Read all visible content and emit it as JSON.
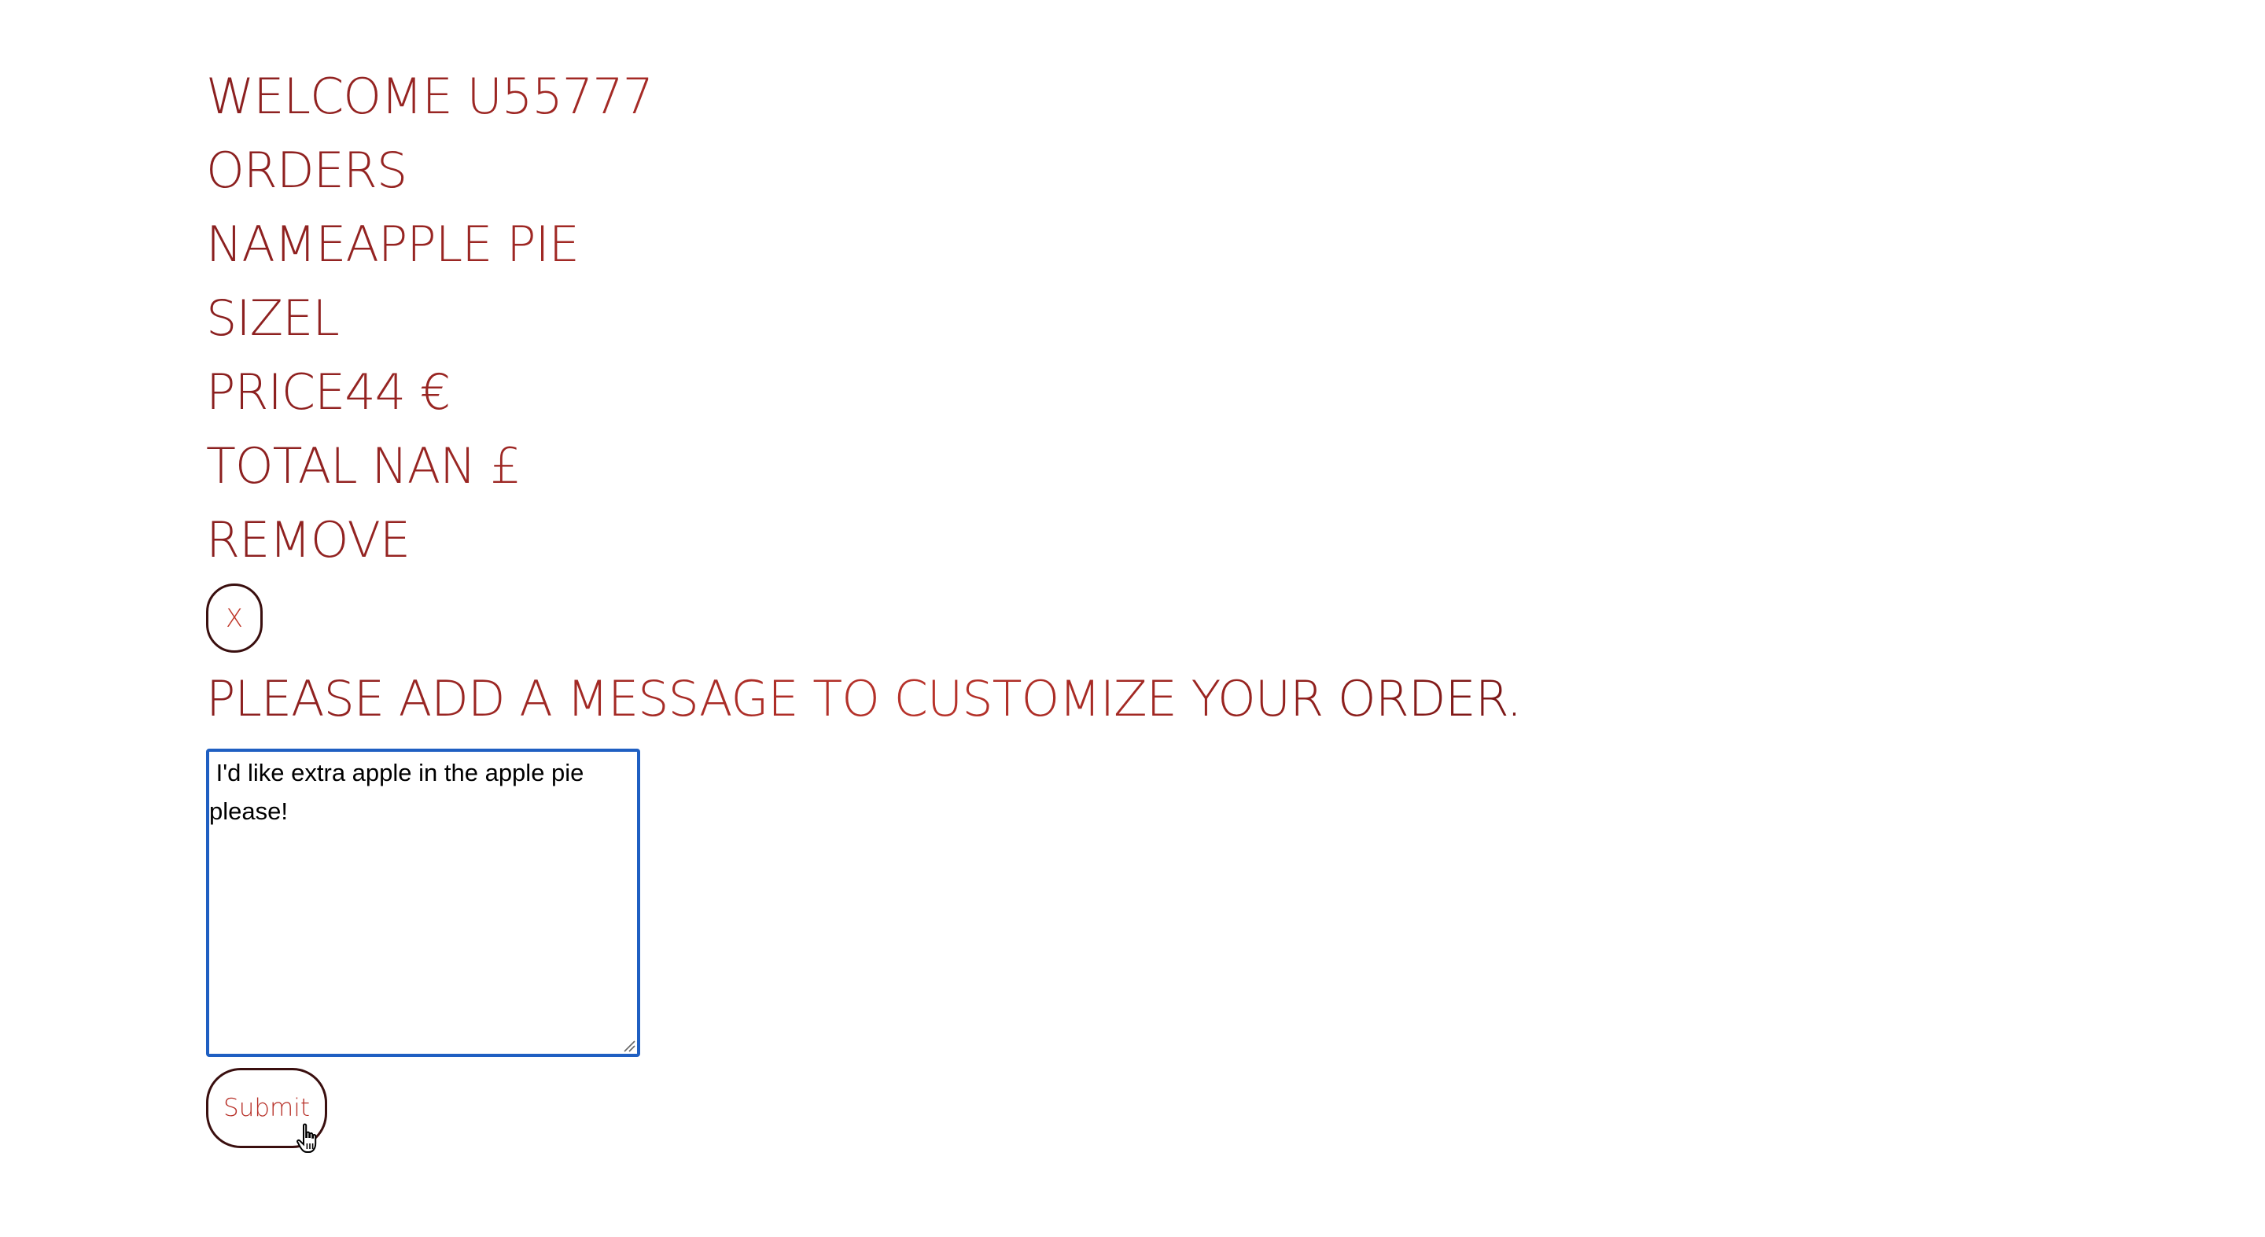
{
  "welcome": "WELCOME U55777",
  "orders_heading": "ORDERS",
  "order": {
    "name_label": "NAME",
    "name_value": "APPLE PIE",
    "size_label": "SIZE",
    "size_value": "L",
    "price_label": "PRICE",
    "price_value": "44 €",
    "total_text": "TOTAL NAN £",
    "remove_label": "REMOVE",
    "remove_button": "X"
  },
  "message": {
    "prompt": "PLEASE ADD A MESSAGE TO CUSTOMIZE YOUR ORDER.",
    "value": " I'd like extra apple in the apple pie please!"
  },
  "submit_label": "Submit",
  "colors": {
    "text_accent": "#b8322a",
    "text_dark": "#7a1616",
    "button_border": "#3a0f0f",
    "focus_border": "#1f5fc2"
  }
}
